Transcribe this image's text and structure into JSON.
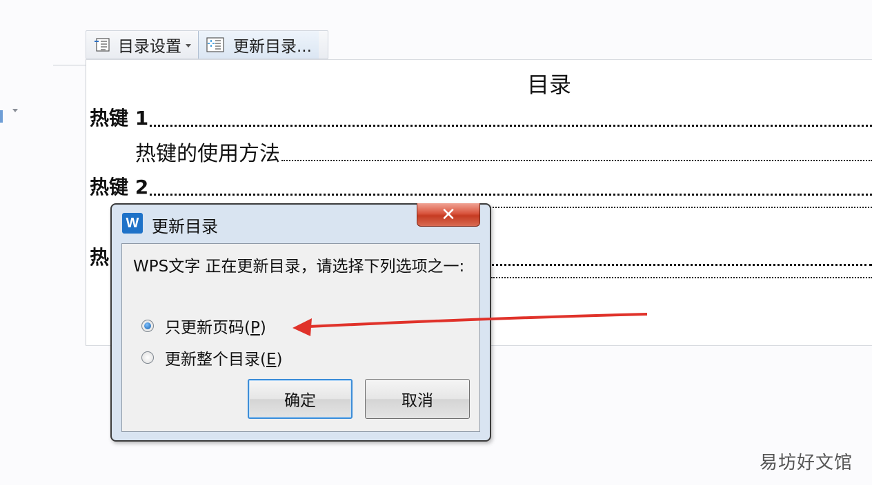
{
  "toc_toolbar": {
    "toc_settings_label": "目录设置",
    "update_toc_label": "更新目录..."
  },
  "document": {
    "toc_title": "目录",
    "entries": [
      {
        "label": "热键 1",
        "level": 1
      },
      {
        "label": "热键的使用方法",
        "level": 2
      },
      {
        "label": "热键 2",
        "level": 1
      },
      {
        "label": "热",
        "level": 1
      }
    ]
  },
  "dialog": {
    "title": "更新目录",
    "app_icon_letter": "W",
    "close_glyph": "✕",
    "message": "WPS文字 正在更新目录，请选择下列选项之一:",
    "options": [
      {
        "label": "只更新页码(",
        "key": "P",
        "suffix": ")",
        "selected": true
      },
      {
        "label": "更新整个目录(",
        "key": "E",
        "suffix": ")",
        "selected": false
      }
    ],
    "ok_label": "确定",
    "cancel_label": "取消"
  },
  "annotation": {
    "arrow_color": "#e0322a"
  },
  "watermark": "易坊好文馆"
}
